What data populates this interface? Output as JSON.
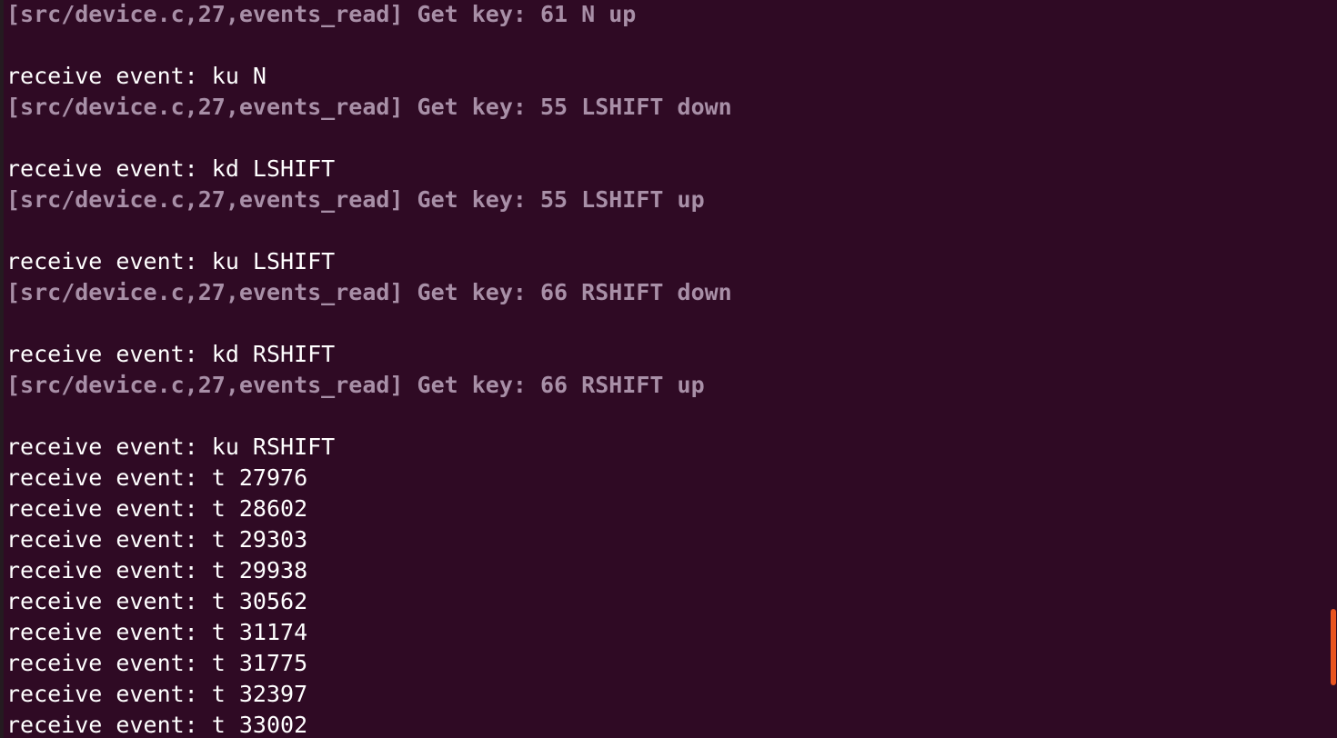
{
  "terminal": {
    "lines": [
      {
        "kind": "debug",
        "text": "[src/device.c,27,events_read] Get key: 61 N up"
      },
      {
        "kind": "blank",
        "text": ""
      },
      {
        "kind": "plain",
        "text": "receive event: ku N"
      },
      {
        "kind": "debug",
        "text": "[src/device.c,27,events_read] Get key: 55 LSHIFT down"
      },
      {
        "kind": "blank",
        "text": ""
      },
      {
        "kind": "plain",
        "text": "receive event: kd LSHIFT"
      },
      {
        "kind": "debug",
        "text": "[src/device.c,27,events_read] Get key: 55 LSHIFT up"
      },
      {
        "kind": "blank",
        "text": ""
      },
      {
        "kind": "plain",
        "text": "receive event: ku LSHIFT"
      },
      {
        "kind": "debug",
        "text": "[src/device.c,27,events_read] Get key: 66 RSHIFT down"
      },
      {
        "kind": "blank",
        "text": ""
      },
      {
        "kind": "plain",
        "text": "receive event: kd RSHIFT"
      },
      {
        "kind": "debug",
        "text": "[src/device.c,27,events_read] Get key: 66 RSHIFT up"
      },
      {
        "kind": "blank",
        "text": ""
      },
      {
        "kind": "plain",
        "text": "receive event: ku RSHIFT"
      },
      {
        "kind": "plain",
        "text": "receive event: t 27976"
      },
      {
        "kind": "plain",
        "text": "receive event: t 28602"
      },
      {
        "kind": "plain",
        "text": "receive event: t 29303"
      },
      {
        "kind": "plain",
        "text": "receive event: t 29938"
      },
      {
        "kind": "plain",
        "text": "receive event: t 30562"
      },
      {
        "kind": "plain",
        "text": "receive event: t 31174"
      },
      {
        "kind": "plain",
        "text": "receive event: t 31775"
      },
      {
        "kind": "plain",
        "text": "receive event: t 32397"
      },
      {
        "kind": "plain",
        "text": "receive event: t 33002"
      }
    ]
  },
  "colors": {
    "background": "#2f0a24",
    "plain_text": "#ffffff",
    "debug_text": "#a88fa7",
    "scroll_thumb": "#e95420"
  }
}
